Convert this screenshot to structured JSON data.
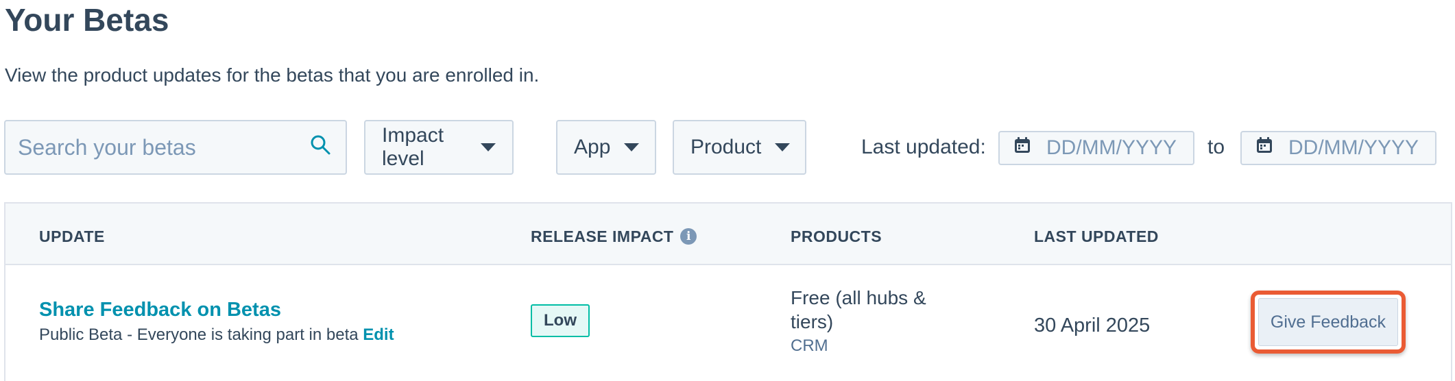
{
  "page": {
    "title": "Your Betas",
    "description": "View the product updates for the betas that you are enrolled in."
  },
  "filters": {
    "search_placeholder": "Search your betas",
    "impact_label": "Impact level",
    "app_label": "App",
    "product_label": "Product",
    "last_updated_label": "Last updated:",
    "date_from_placeholder": "DD/MM/YYYY",
    "to_label": "to",
    "date_to_placeholder": "DD/MM/YYYY"
  },
  "table": {
    "headers": {
      "update": "UPDATE",
      "release_impact": "RELEASE IMPACT",
      "products": "PRODUCTS",
      "last_updated": "LAST UPDATED"
    },
    "rows": [
      {
        "title": "Share Feedback on Betas",
        "subtitle": "Public Beta - Everyone is taking part in beta",
        "edit_label": "Edit",
        "impact": "Low",
        "products": "Free (all hubs & tiers)",
        "product_tag": "CRM",
        "last_updated": "30 April 2025",
        "action_label": "Give Feedback"
      }
    ]
  },
  "icons": {
    "search": "search-icon",
    "caret": "caret-down-icon",
    "calendar": "calendar-icon",
    "info": "info-icon"
  },
  "colors": {
    "link": "#0091ae",
    "text": "#33475b",
    "badge_border": "#00bda5",
    "highlight": "#ea5b34"
  }
}
